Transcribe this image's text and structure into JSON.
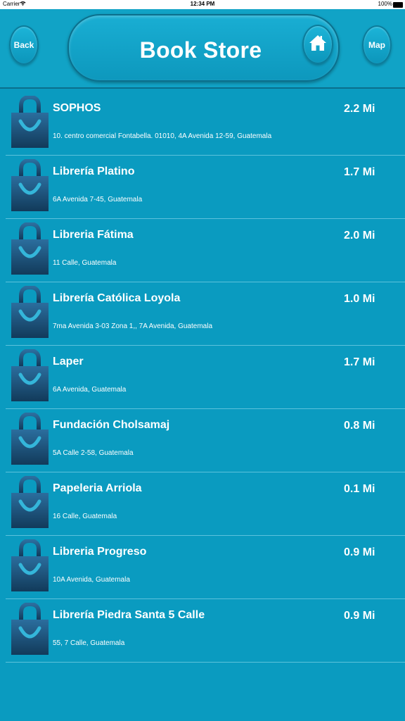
{
  "status_bar": {
    "carrier": "Carrier",
    "time": "12:34 PM",
    "battery": "100%"
  },
  "header": {
    "back_label": "Back",
    "title": "Book Store",
    "map_label": "Map"
  },
  "colors": {
    "background": "#0a9bc0",
    "header": "#11a3c6",
    "bag_top": "#2b6e9e",
    "bag_bottom": "#123a5a",
    "bag_handle": "#34b6da"
  },
  "stores": [
    {
      "name": "SOPHOS",
      "address": "10. centro comercial Fontabella. 01010, 4A Avenida 12-59, Guatemala",
      "distance": "2.2 Mi"
    },
    {
      "name": "Librería Platino",
      "address": "6A Avenida 7-45, Guatemala",
      "distance": "1.7 Mi"
    },
    {
      "name": "Libreria Fátima",
      "address": "11 Calle, Guatemala",
      "distance": "2.0 Mi"
    },
    {
      "name": "Librería Católica Loyola",
      "address": "7ma Avenida 3-03 Zona 1,, 7A Avenida, Guatemala",
      "distance": "1.0 Mi"
    },
    {
      "name": "Laper",
      "address": "6A Avenida, Guatemala",
      "distance": "1.7 Mi"
    },
    {
      "name": "Fundación Cholsamaj",
      "address": "5A Calle 2-58, Guatemala",
      "distance": "0.8 Mi"
    },
    {
      "name": "Papeleria Arriola",
      "address": "16 Calle, Guatemala",
      "distance": "0.1 Mi"
    },
    {
      "name": "Libreria Progreso",
      "address": "10A Avenida, Guatemala",
      "distance": "0.9 Mi"
    },
    {
      "name": "Librería Piedra Santa 5 Calle",
      "address": "55, 7 Calle, Guatemala",
      "distance": "0.9 Mi"
    }
  ]
}
